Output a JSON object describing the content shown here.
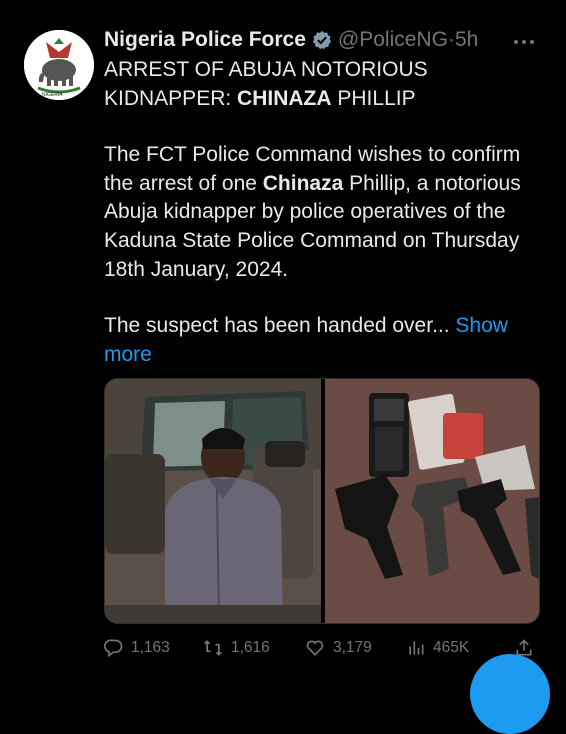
{
  "tweet": {
    "author_name": "Nigeria Police Force",
    "handle": "@PoliceNG",
    "separator": "·",
    "time": "5h",
    "more_icon": "more-horizontal-icon",
    "title_line1": "ARREST OF ABUJA NOTORIOUS",
    "title_line2_prefix": "KIDNAPPER: ",
    "title_line2_bold": "CHINAZA",
    "title_line2_suffix": " PHILLIP",
    "para1_a": "The FCT Police Command wishes to confirm the arrest of one ",
    "para1_bold": "Chinaza",
    "para1_b": " Phillip, a notorious Abuja kidnapper by police operatives of the Kaduna State Police Command on Thursday 18th January, 2024.",
    "para2": "The suspect has been handed over... ",
    "show_more": "Show more",
    "avatar_caption": "NIGERIA"
  },
  "actions": {
    "replies": "1,163",
    "reposts": "1,616",
    "likes": "3,179",
    "views": "465K"
  },
  "colors": {
    "background": "#000000",
    "text": "#e7e9ea",
    "muted": "#71767b",
    "accent": "#1d9bf0"
  },
  "icons": [
    "verified-badge-icon",
    "reply-icon",
    "repost-icon",
    "like-icon",
    "views-icon",
    "share-icon"
  ]
}
